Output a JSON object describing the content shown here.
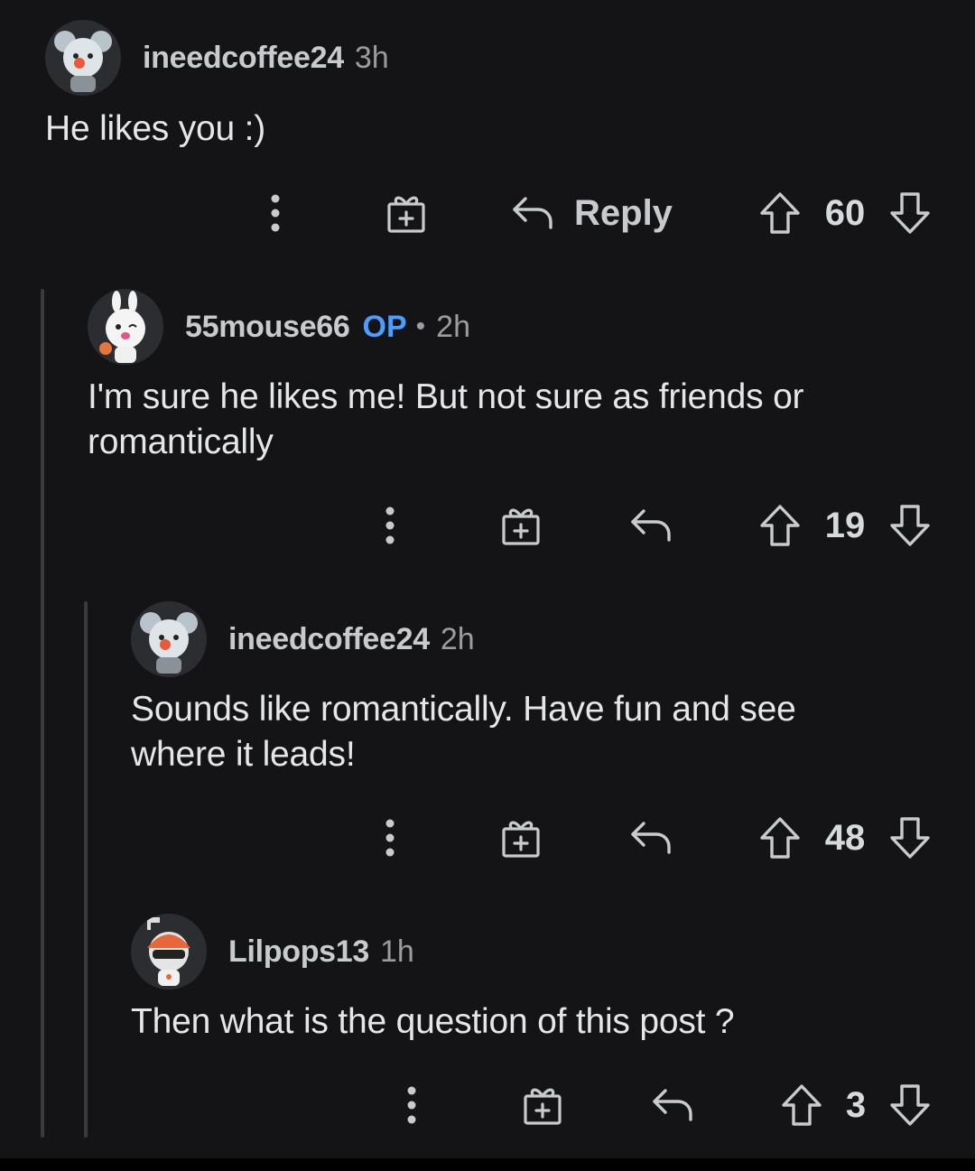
{
  "comments": [
    {
      "username": "ineedcoffee24",
      "op_badge": "",
      "separator": "",
      "time": "3h",
      "body_lines": [
        "He likes you :)"
      ],
      "reply_label": "Reply",
      "score": "60",
      "avatar_icon": "koala-avatar-icon"
    },
    {
      "username": "55mouse66",
      "op_badge": "OP",
      "separator": "•",
      "time": "2h",
      "body_lines": [
        "I'm sure he likes me! But not sure as friends or",
        "romantically"
      ],
      "reply_label": "",
      "score": "19",
      "avatar_icon": "bunny-avatar-icon"
    },
    {
      "username": "ineedcoffee24",
      "op_badge": "",
      "separator": "",
      "time": "2h",
      "body_lines": [
        "Sounds like romantically. Have fun and see",
        "where it leads!"
      ],
      "reply_label": "",
      "score": "48",
      "avatar_icon": "koala-avatar-icon"
    },
    {
      "username": "Lilpops13",
      "op_badge": "",
      "separator": "",
      "time": "1h",
      "body_lines": [
        "Then what is the question of this post ?"
      ],
      "reply_label": "",
      "score": "3",
      "avatar_icon": "helmet-avatar-icon"
    }
  ],
  "colors": {
    "background": "#141416",
    "op_badge": "#4a9eff",
    "thread_line": "#3a3a3c"
  },
  "icons": {
    "more": "more-options-icon",
    "award": "gift-award-icon",
    "reply": "reply-arrow-icon",
    "upvote": "upvote-icon",
    "downvote": "downvote-icon"
  }
}
